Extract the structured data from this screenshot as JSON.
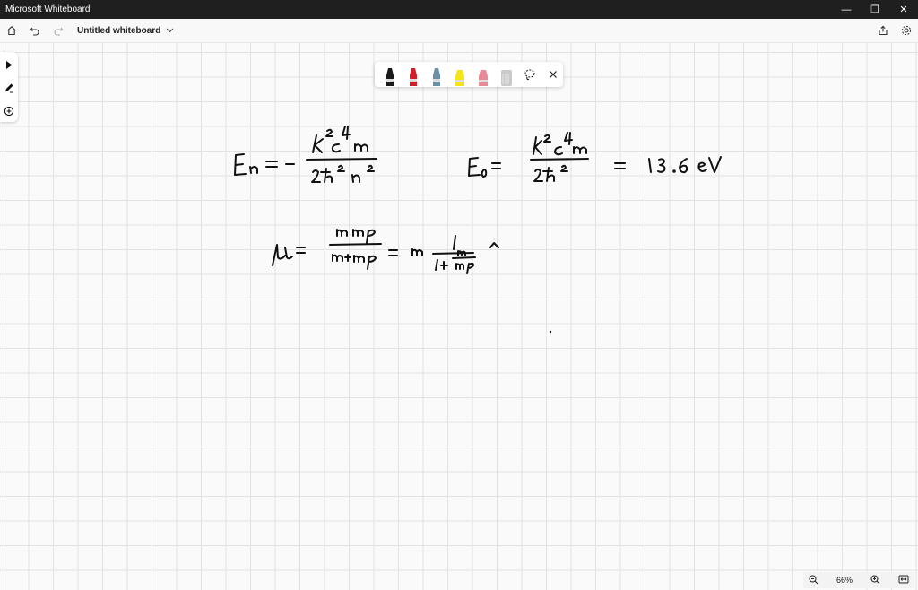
{
  "window": {
    "app_title": "Microsoft Whiteboard",
    "minimize": "—",
    "restore": "❐",
    "close": "✕"
  },
  "appbar": {
    "board_title": "Untitled whiteboard"
  },
  "pen_toolbar": {
    "pens": [
      {
        "name": "black-pen",
        "color": "#1a1a1a"
      },
      {
        "name": "red-pen",
        "color": "#d21f2b"
      },
      {
        "name": "blue-pen",
        "color": "#6a8fa6"
      },
      {
        "name": "yellow-highlighter",
        "color": "#f5e41a"
      },
      {
        "name": "pink-highlighter",
        "color": "#e98a98"
      },
      {
        "name": "eraser",
        "color": "#c9c9c9"
      }
    ]
  },
  "ink_text": {
    "eq1_lhs": "En = -",
    "eq1_num": "k²e⁴m",
    "eq1_den": "2ħ² n²",
    "eq2_lhs": "E₀ =",
    "eq2_num": "k²e⁴m",
    "eq2_den": "2ħ²",
    "eq2_rhs": "= 13.6 eV",
    "eq3_lhs": "μ =",
    "eq3_num": "m mp",
    "eq3_den": "m+mp",
    "eq3_mid": "= m",
    "eq3_frac_num": "1",
    "eq3_frac_den_a": "1+",
    "eq3_frac_den_num": "m",
    "eq3_frac_den_den": "mp",
    "eq3_tail": "^"
  },
  "zoom": {
    "level": "66%"
  }
}
